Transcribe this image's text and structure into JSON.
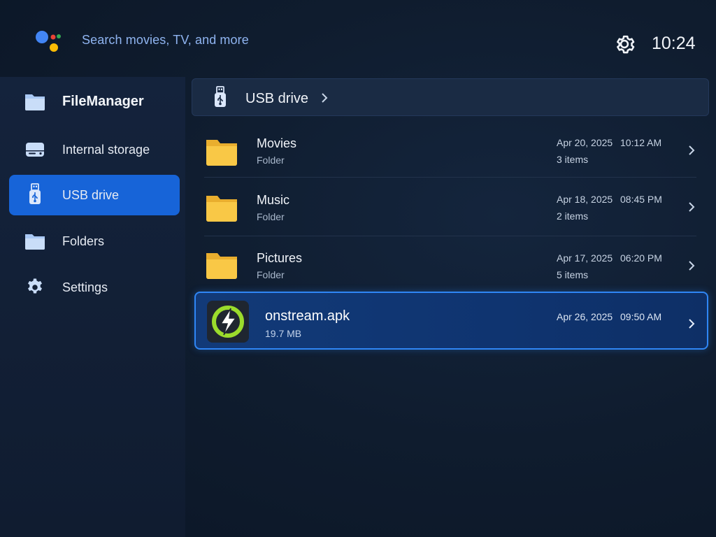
{
  "topbar": {
    "search_placeholder": "Search movies, TV, and more",
    "clock": "10:24",
    "icons": [
      "google-assistant-icon",
      "gear-icon"
    ]
  },
  "sidebar": {
    "items": [
      {
        "label": "FileManager",
        "icon": "folder-icon",
        "active": false
      },
      {
        "label": "Internal storage",
        "icon": "hard-drive-icon",
        "active": false
      },
      {
        "label": "USB drive",
        "icon": "usb-icon",
        "active": true
      },
      {
        "label": "Folders",
        "icon": "folder-icon",
        "active": false
      },
      {
        "label": "Settings",
        "icon": "gear-icon",
        "active": false
      }
    ]
  },
  "breadcrumb": {
    "label": "USB drive",
    "icon": "usb-icon"
  },
  "files": [
    {
      "name": "Movies",
      "type": "Folder",
      "date": "Apr 20, 2025",
      "time": "10:12 AM",
      "count": "3 items"
    },
    {
      "name": "Music",
      "type": "Folder",
      "date": "Apr 18, 2025",
      "time": "08:45 PM",
      "count": "2 items"
    },
    {
      "name": "Pictures",
      "type": "Folder",
      "date": "Apr 17, 2025",
      "time": "06:20 PM",
      "count": "5 items"
    },
    {
      "name": "onstream.apk",
      "size": "19.7 MB",
      "date": "Apr 26, 2025",
      "time": "09:50 AM",
      "selected": true,
      "icon": "onstream-app-icon"
    }
  ],
  "colors": {
    "accent": "#1764d8",
    "selection_border": "#2f86f5",
    "folder": "#f9c846",
    "search_text": "#8fb4f0"
  }
}
